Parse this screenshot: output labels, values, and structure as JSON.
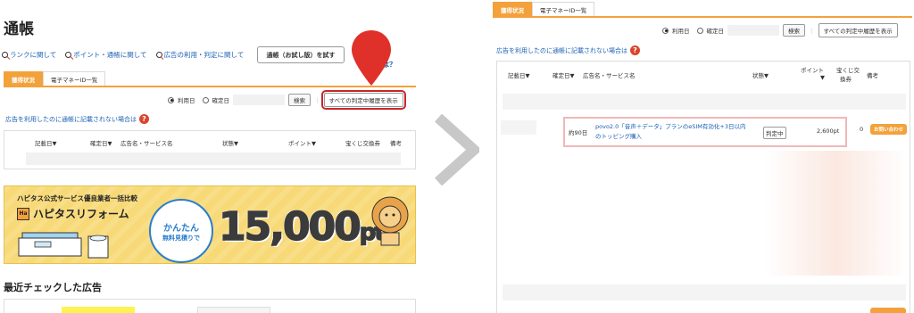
{
  "left": {
    "page_title": "通帳",
    "links": [
      {
        "label": "ランクに関して"
      },
      {
        "label": "ポイント・通帳に関して"
      },
      {
        "label": "広告の利用・判定に関して"
      }
    ],
    "trial_button": "通帳（お試し版）を試す",
    "help_link": "とは？",
    "tabs": [
      "獲得状況",
      "電子マネーID一覧"
    ],
    "filter": {
      "radio_use": "利用日",
      "radio_confirm": "確定日",
      "search_button": "検索",
      "separator": "｜",
      "all_button": "すべての判定中履歴を表示"
    },
    "note": "広告を利用したのに通帳に記載されない場合は",
    "table_headers": [
      "記載日▼",
      "確定日▼",
      "広告名・サービス名",
      "状態▼",
      "ポイント▼",
      "宝くじ交換券",
      "備考"
    ],
    "banner": {
      "subtitle": "ハピタス公式サービス優良業者一括比較",
      "logo_mark": "Ha",
      "logo_text": "ハピタスリフォーム",
      "circle_line1": "かんたん",
      "circle_line2": "無料見積りで",
      "amount": "15,000",
      "unit": "pt"
    },
    "recent_title": "最近チェックした広告"
  },
  "right": {
    "tabs": [
      "獲得状況",
      "電子マネーID一覧"
    ],
    "filter": {
      "radio_use": "利用日",
      "radio_confirm": "確定日",
      "search_button": "検索",
      "separator": "｜",
      "all_button": "すべての判定中履歴を表示"
    },
    "note": "広告を利用したのに通帳に記載されない場合は",
    "table_headers": {
      "date": "記載日▼",
      "confirm": "確定日▼",
      "name": "広告名・サービス名",
      "status": "状態▼",
      "points_1": "ポイント",
      "points_2": "▼",
      "lottery_1": "宝くじ交",
      "lottery_2": "換券",
      "remarks": "備考"
    },
    "row": {
      "confirm_date": "約90日",
      "name_line1": "povo2.0「音声＋データ」プランのeSIM有効化+3日以内",
      "name_line2": "のトッピング購入",
      "status": "判定中",
      "points": "2,600pt",
      "lottery": "0",
      "inquiry": "お問い合わせ"
    }
  },
  "colors": {
    "accent": "#f3a13a",
    "link": "#1a5fb4",
    "highlight": "#c62828",
    "pin": "#e0302a"
  }
}
